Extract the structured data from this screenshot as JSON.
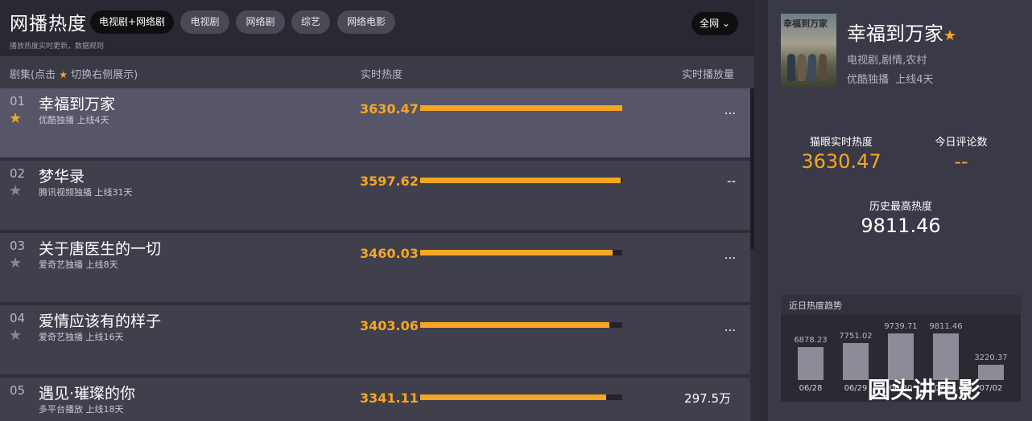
{
  "page_title": "网播热度",
  "note": "播放热度实时更新，数据规则",
  "tabs": [
    {
      "label": "电视剧+网络剧",
      "active": true
    },
    {
      "label": "电视剧"
    },
    {
      "label": "网络剧"
    },
    {
      "label": "综艺"
    },
    {
      "label": "网络电影"
    }
  ],
  "scope_dropdown": "全网 ⌄",
  "columns": {
    "series_prefix": "剧集(点击",
    "series_suffix": "切换右侧展示)",
    "heat": "实时热度",
    "playcount": "实时播放量"
  },
  "rows": [
    {
      "rank": "01",
      "title": "幸福到万家",
      "platform": "优酷独播",
      "days": "上线4天",
      "heat": "3630.47",
      "heat_value": 3630.47,
      "playcount": "...",
      "starred": true,
      "selected": true
    },
    {
      "rank": "02",
      "title": "梦华录",
      "platform": "腾讯视频独播",
      "days": "上线31天",
      "heat": "3597.62",
      "heat_value": 3597.62,
      "playcount": "--",
      "starred": false
    },
    {
      "rank": "03",
      "title": "关于唐医生的一切",
      "platform": "爱奇艺独播",
      "days": "上线8天",
      "heat": "3460.03",
      "heat_value": 3460.03,
      "playcount": "...",
      "starred": false
    },
    {
      "rank": "04",
      "title": "爱情应该有的样子",
      "platform": "爱奇艺独播",
      "days": "上线16天",
      "heat": "3403.06",
      "heat_value": 3403.06,
      "playcount": "...",
      "starred": false
    },
    {
      "rank": "05",
      "title": "遇见·璀璨的你",
      "platform": "多平台播放",
      "days": "上线18天",
      "heat": "3341.11",
      "heat_value": 3341.11,
      "playcount": "297.5万",
      "starred": false
    }
  ],
  "detail": {
    "poster_text": "幸福到万家",
    "title": "幸福到万家",
    "genre": "电视剧,剧情,农村",
    "platform": "优酷独播",
    "days": "上线4天",
    "stats": {
      "heat_label": "猫眼实时热度",
      "heat_value": "3630.47",
      "comments_label": "今日评论数",
      "comments_value": "--",
      "peak_label": "历史最高热度",
      "peak_value": "9811.46"
    },
    "trend": {
      "title": "近日热度趋势",
      "points": [
        {
          "date": "06/28",
          "value": 6878.23,
          "label": "6878.23"
        },
        {
          "date": "06/29",
          "value": 7751.02,
          "label": "7751.02"
        },
        {
          "date": "06/30",
          "value": 9739.71,
          "label": "9739.71"
        },
        {
          "date": "07/01",
          "value": 9811.46,
          "label": "9811.46"
        },
        {
          "date": "07/02",
          "value": 3220.37,
          "label": "3220.37"
        }
      ]
    }
  },
  "watermark": "圆头讲电影",
  "colors": {
    "accent": "#f6a623",
    "selected_row": "#575668",
    "row": "#403f4c",
    "active_tab": "#0f0f12"
  },
  "icons": {
    "star": "star-icon",
    "dropdown": "chevron-down-icon"
  }
}
